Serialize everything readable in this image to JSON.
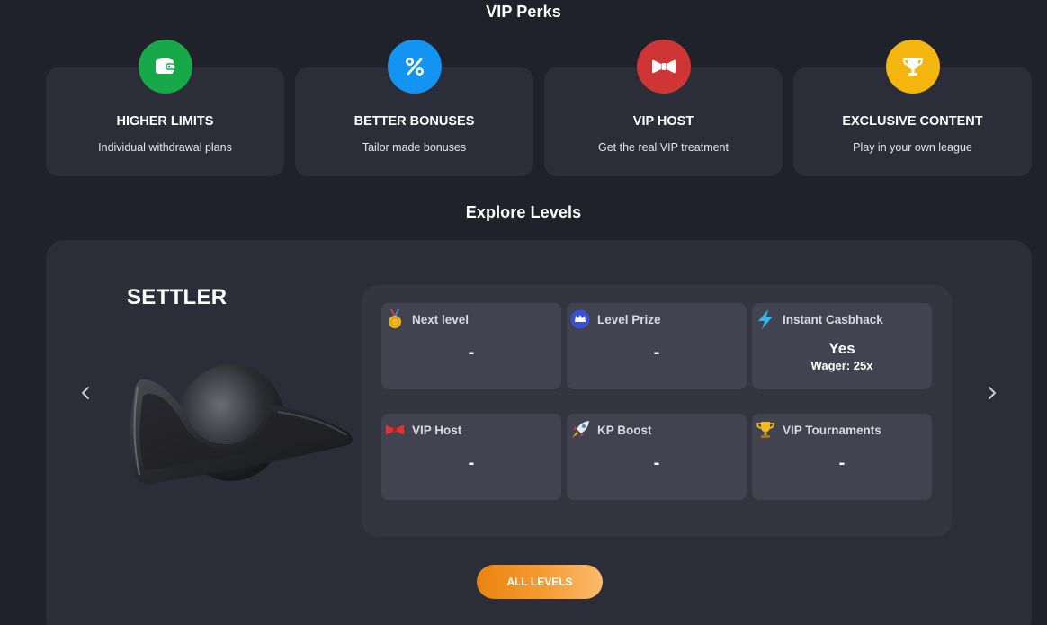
{
  "perks_section": {
    "title": "VIP Perks",
    "items": [
      {
        "name": "HIGHER LIMITS",
        "description": "Individual withdrawal plans",
        "icon": "wallet-icon",
        "color": "#17a84a"
      },
      {
        "name": "BETTER BONUSES",
        "description": "Tailor made bonuses",
        "icon": "percent-icon",
        "color": "#1393f2"
      },
      {
        "name": "VIP HOST",
        "description": "Get the real VIP treatment",
        "icon": "bowtie-icon",
        "color": "#d23a3a"
      },
      {
        "name": "EXCLUSIVE CONTENT",
        "description": "Play in your own league",
        "icon": "trophy-icon",
        "color": "#f5b50f"
      }
    ]
  },
  "levels_section": {
    "title": "Explore Levels",
    "level": {
      "name": "SETTLER",
      "image": "tricorn-hat"
    },
    "stats": [
      {
        "label": "Next level",
        "value": "-",
        "icon": "medal-icon"
      },
      {
        "label": "Level Prize",
        "value": "-",
        "icon": "crown-badge-icon"
      },
      {
        "label": "Instant Casbhack",
        "value": "Yes",
        "sub": "Wager: 25x",
        "icon": "lightning-icon"
      },
      {
        "label": "VIP Host",
        "value": "-",
        "icon": "bowtie-icon"
      },
      {
        "label": "KP Boost",
        "value": "-",
        "icon": "rocket-icon"
      },
      {
        "label": "VIP Tournaments",
        "value": "-",
        "icon": "trophy-icon"
      }
    ],
    "all_levels_label": "ALL LEVELS"
  },
  "colors": {
    "background": "#1f222a",
    "card": "#2b2e38",
    "stats_box": "#333641",
    "tile": "#414450",
    "accent_orange": "#ea8412"
  }
}
